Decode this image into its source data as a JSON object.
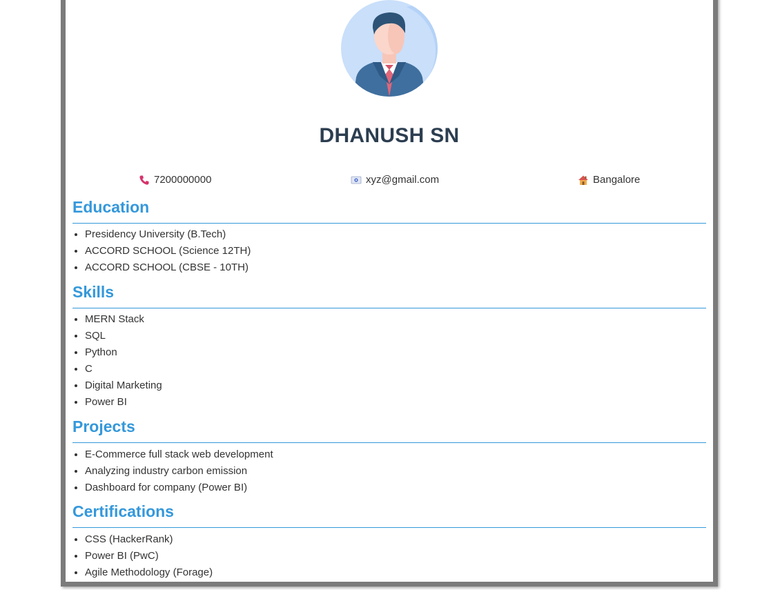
{
  "profile": {
    "name": "DHANUSH SN",
    "avatar_icon": "businessman-avatar-icon"
  },
  "contact": {
    "phone": {
      "icon": "phone-icon",
      "value": "7200000000"
    },
    "email": {
      "icon": "email-icon",
      "value": "xyz@gmail.com"
    },
    "location": {
      "icon": "house-icon",
      "value": "Bangalore"
    }
  },
  "sections": {
    "education": {
      "title": "Education",
      "items": [
        "Presidency University (B.Tech)",
        "ACCORD SCHOOL (Science 12TH)",
        "ACCORD SCHOOL (CBSE - 10TH)"
      ]
    },
    "skills": {
      "title": "Skills",
      "items": [
        "MERN Stack",
        "SQL",
        "Python",
        "C",
        "Digital Marketing",
        "Power BI"
      ]
    },
    "projects": {
      "title": "Projects",
      "items": [
        "E-Commerce full stack web development",
        "Analyzing industry carbon emission",
        "Dashboard for company (Power BI)"
      ]
    },
    "certifications": {
      "title": "Certifications",
      "items": [
        "CSS (HackerRank)",
        "Power BI (PwC)",
        "Agile Methodology (Forage)"
      ]
    }
  },
  "colors": {
    "accent": "#3498db",
    "name": "#2c3e50",
    "frame": "#7b7b7b"
  }
}
